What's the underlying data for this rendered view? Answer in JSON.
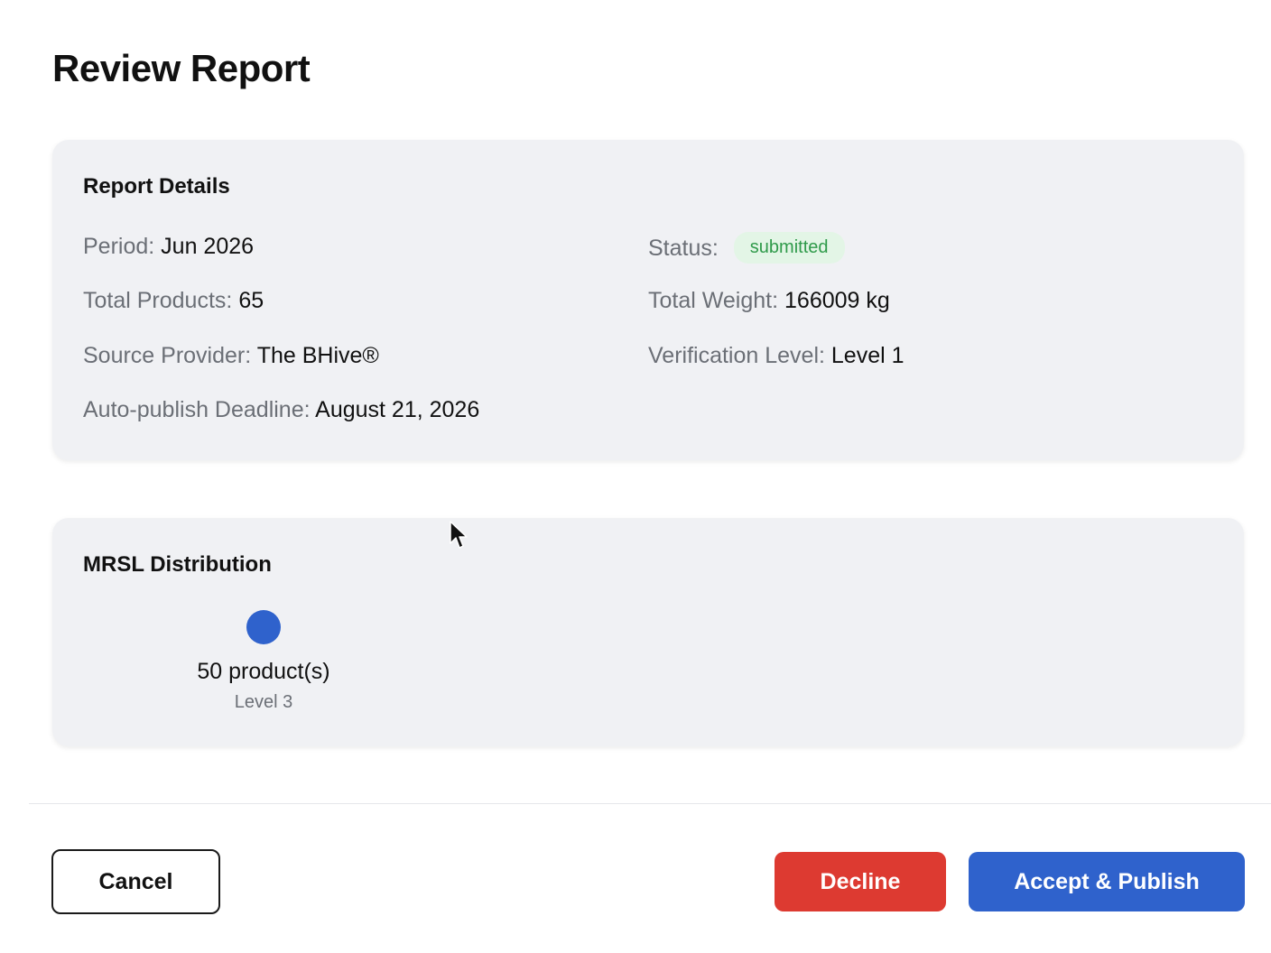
{
  "page": {
    "title": "Review Report"
  },
  "report_details": {
    "title": "Report Details",
    "period": {
      "label": "Period:",
      "value": "Jun 2026"
    },
    "status": {
      "label": "Status:",
      "value": "submitted"
    },
    "total_products": {
      "label": "Total Products:",
      "value": "65"
    },
    "total_weight": {
      "label": "Total Weight:",
      "value": "166009 kg"
    },
    "source_provider": {
      "label": "Source Provider:",
      "value": "The BHive®"
    },
    "verification_level": {
      "label": "Verification Level:",
      "value": "Level 1"
    },
    "auto_publish_deadline": {
      "label": "Auto-publish Deadline:",
      "value": "August 21, 2026"
    }
  },
  "mrsl_distribution": {
    "title": "MRSL Distribution",
    "items": [
      {
        "count_label": "50 product(s)",
        "level": "Level 3",
        "color": "#2f62cc"
      }
    ]
  },
  "actions": {
    "cancel": "Cancel",
    "decline": "Decline",
    "accept": "Accept & Publish"
  },
  "colors": {
    "primary": "#2f62cc",
    "danger": "#dd3a31",
    "status_success_bg": "#e3f5e6",
    "status_success_text": "#2f9a4a"
  }
}
